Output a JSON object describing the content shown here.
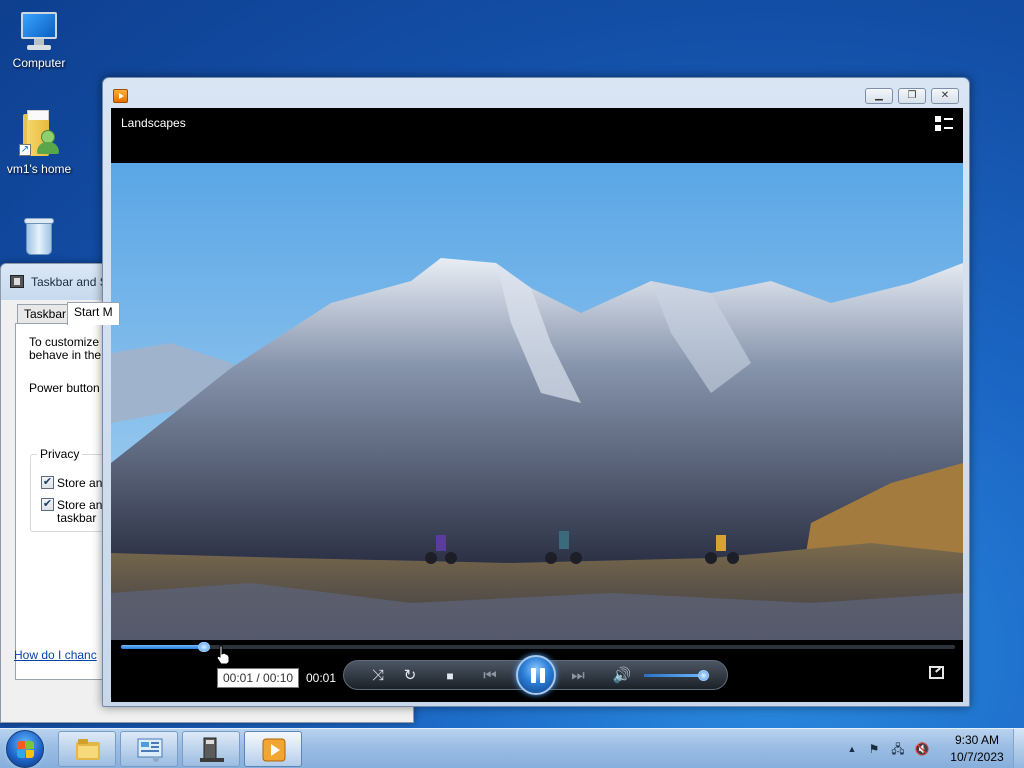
{
  "desktop": {
    "icons": [
      {
        "label": "Computer"
      },
      {
        "label": "vm1's home"
      },
      {
        "label": ""
      }
    ]
  },
  "properties_dialog": {
    "title": "Taskbar and S",
    "tabs": [
      "Taskbar",
      "Start M"
    ],
    "text_lines": [
      "To customize ho",
      "behave in the S",
      "Power button a"
    ],
    "privacy_label": "Privacy",
    "checkboxes": [
      {
        "label": "Store and",
        "checked": true
      },
      {
        "label": "Store and",
        "label2": "taskbar",
        "checked": true
      }
    ],
    "help_link": "How do I chanc"
  },
  "media_player": {
    "title": "Landscapes",
    "caption_buttons": [
      "minimize",
      "restore",
      "close"
    ],
    "playback": {
      "progress_fraction": 0.1,
      "tooltip": "00:01 / 00:10",
      "elapsed": "00:01",
      "state": "playing",
      "volume_fraction": 0.9
    }
  },
  "taskbar": {
    "pinned": [
      "windows-explorer",
      "control-panel",
      "taskbar-properties",
      "windows-media-player"
    ],
    "clock_time": "9:30 AM",
    "clock_date": "10/7/2023"
  },
  "colors": {
    "desktop_blue": "#1b67c4",
    "accent_blue": "#2b7dd6"
  }
}
